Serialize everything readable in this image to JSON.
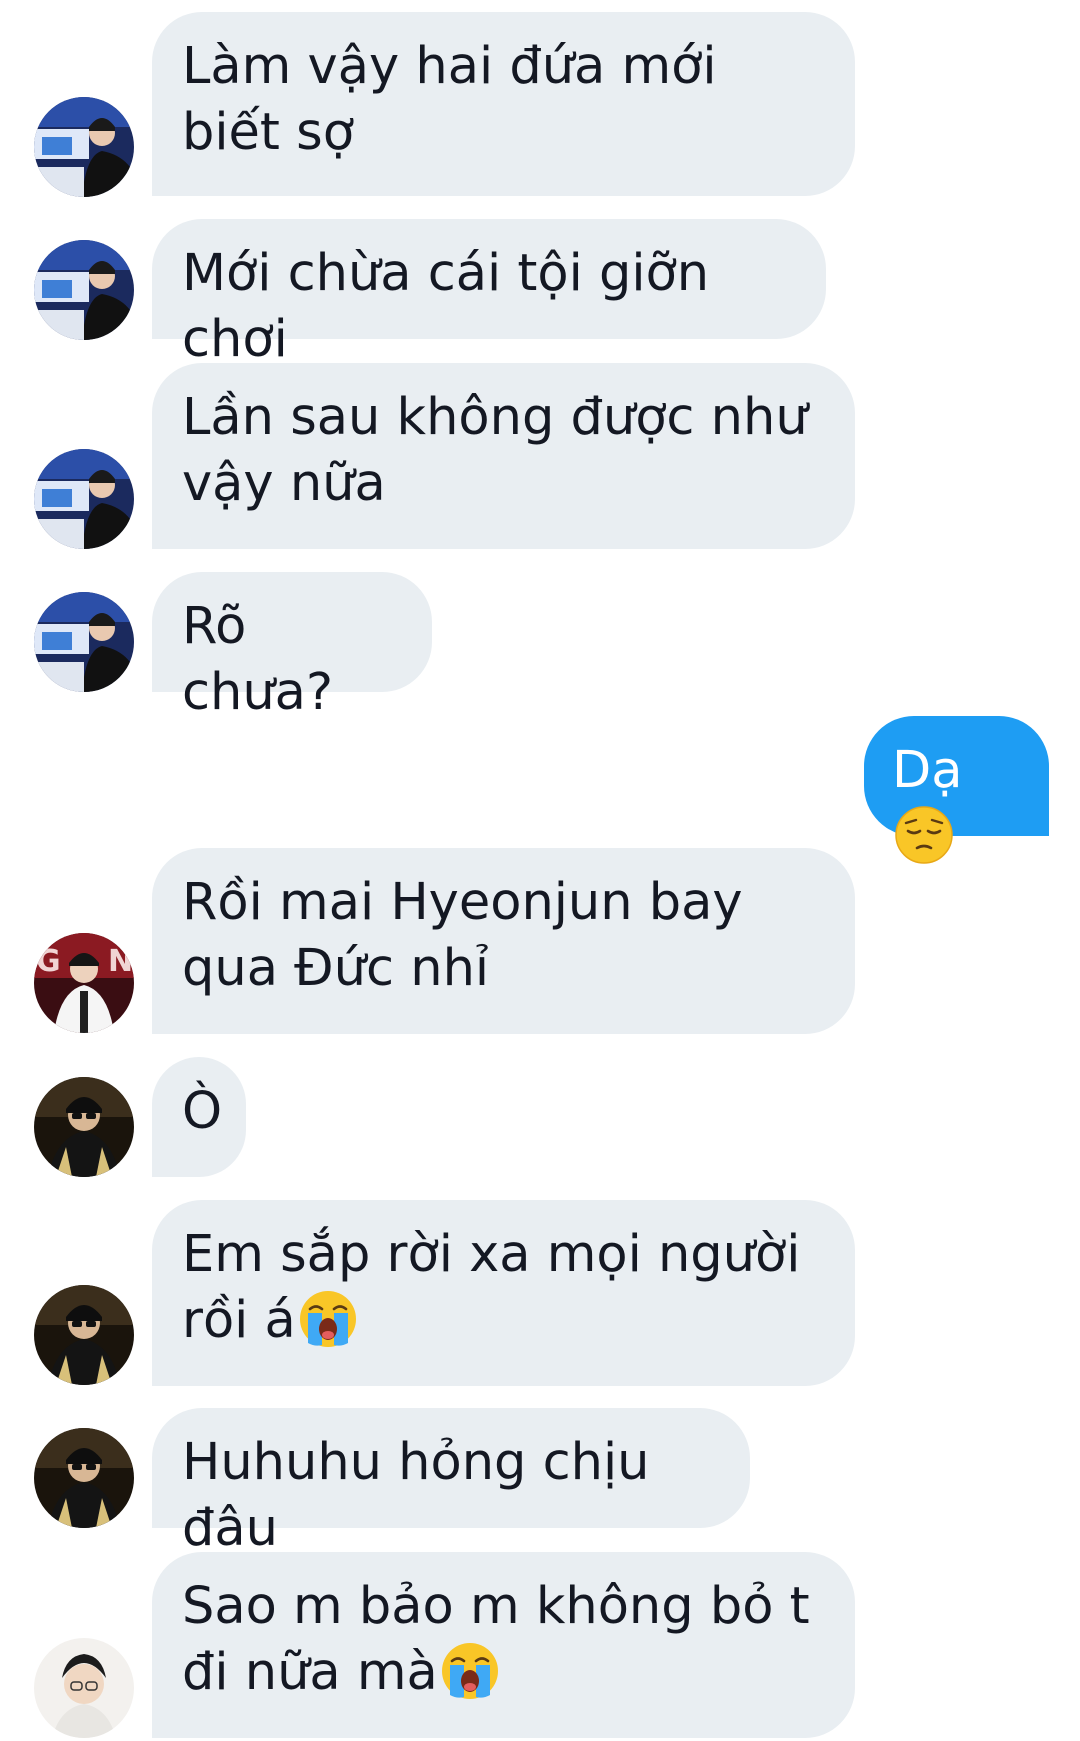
{
  "conversation": {
    "messages": [
      {
        "sender": "other",
        "text": "Làm vậy hai đứa mới biết sợ"
      },
      {
        "sender": "other",
        "text": "Mới chừa cái tội giỡn chơi"
      },
      {
        "sender": "other",
        "text": "Lần sau không được như vậy nữa"
      },
      {
        "sender": "other",
        "text": "Rõ chưa?"
      },
      {
        "sender": "me",
        "text": "Dạ",
        "emoji": "pensive-face-emoji"
      },
      {
        "sender": "other",
        "text": "Rồi mai Hyeonjun bay qua Đức nhỉ"
      },
      {
        "sender": "other",
        "text": "Ò"
      },
      {
        "sender": "other",
        "text": "Em sắp rời xa mọi người rồi á",
        "emoji": "loudly-crying-face-emoji"
      },
      {
        "sender": "other",
        "text": "Huhuhu hỏng chịu đâu"
      },
      {
        "sender": "other",
        "text": "Sao m bảo m không bỏ t đi nữa mà",
        "emoji": "loudly-crying-face-emoji"
      }
    ]
  },
  "colors": {
    "incoming_bubble": "#e9eef2",
    "outgoing_bubble": "#1e9df3",
    "incoming_text": "#141823",
    "outgoing_text": "#ffffff"
  }
}
